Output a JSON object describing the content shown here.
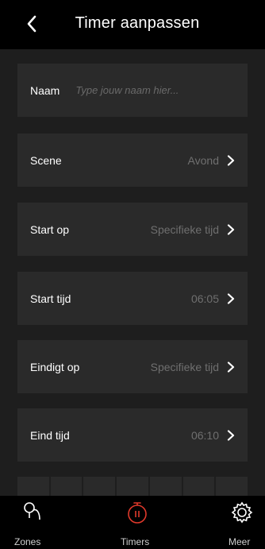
{
  "header": {
    "title": "Timer aanpassen",
    "back_icon": "chevron-left-icon"
  },
  "form": {
    "naam": {
      "label": "Naam",
      "placeholder": "Type jouw naam hier..."
    },
    "scene": {
      "label": "Scene",
      "value": "Avond"
    },
    "start_op": {
      "label": "Start op",
      "value": "Specifieke tijd"
    },
    "start_tijd": {
      "label": "Start tijd",
      "value": "06:05"
    },
    "eindigt_op": {
      "label": "Eindigt op",
      "value": "Specifieke tijd"
    },
    "eind_tijd": {
      "label": "Eind tijd",
      "value": "06:10"
    }
  },
  "tabbar": {
    "tabs": [
      {
        "label": "Zones",
        "icon": "zones-icon",
        "active": false
      },
      {
        "label": "Timers",
        "icon": "timer-icon",
        "active": true
      },
      {
        "label": "Meer",
        "icon": "gear-icon",
        "active": false
      }
    ],
    "active_color": "#e0392b"
  },
  "colors": {
    "background": "#1e1e1e",
    "row": "#2a2a2a",
    "header": "#000000",
    "accent": "#e0392b"
  }
}
